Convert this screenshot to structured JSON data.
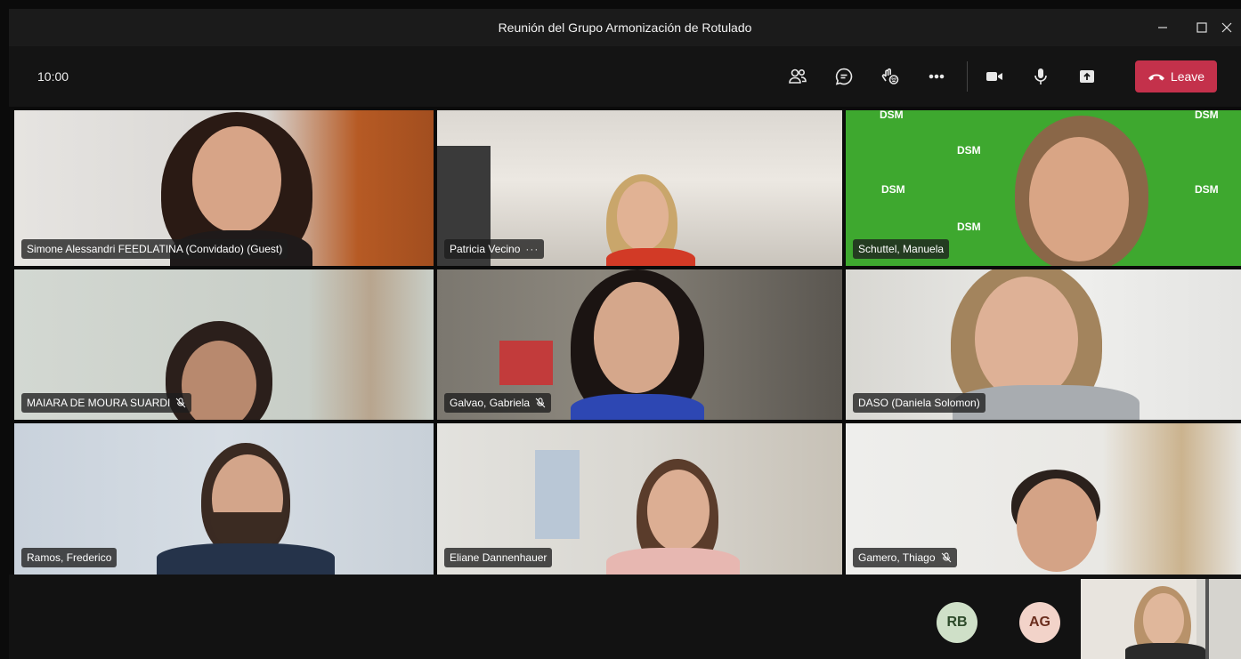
{
  "window": {
    "title": "Reunión del Grupo Armonización de Rotulado"
  },
  "toolbar": {
    "timer": "10:00",
    "leave_label": "Leave",
    "leave_color": "#c4314b",
    "icons": [
      "participants-icon",
      "chat-icon",
      "reactions-icon",
      "more-icon",
      "camera-icon",
      "microphone-icon",
      "share-icon"
    ]
  },
  "tiles": [
    {
      "name": "Simone Alessandri FEEDLATINA (Convidado) (Guest)",
      "muted": false,
      "more": false
    },
    {
      "name": "Patricia Vecino",
      "muted": false,
      "more": true
    },
    {
      "name": "Schuttel, Manuela",
      "muted": false,
      "more": false
    },
    {
      "name": "MAIARA DE MOURA SUARDI",
      "muted": true,
      "more": false
    },
    {
      "name": "Galvao, Gabriela",
      "muted": true,
      "more": false
    },
    {
      "name": "DASO (Daniela Solomon)",
      "muted": false,
      "more": false
    },
    {
      "name": "Ramos, Frederico",
      "muted": false,
      "more": false
    },
    {
      "name": "Eliane Dannenhauer",
      "muted": false,
      "more": false
    },
    {
      "name": "Gamero, Thiago",
      "muted": true,
      "more": false
    }
  ],
  "backgrounds": {
    "dsm_logo_text": "DSM",
    "dsm_green": "#3ea82f"
  },
  "bottom": {
    "avatars": [
      {
        "initials": "RB",
        "bg": "#cfe0c8",
        "fg": "#2d4a2a"
      },
      {
        "initials": "AG",
        "bg": "#f2d3c9",
        "fg": "#6b2e1e"
      }
    ]
  }
}
